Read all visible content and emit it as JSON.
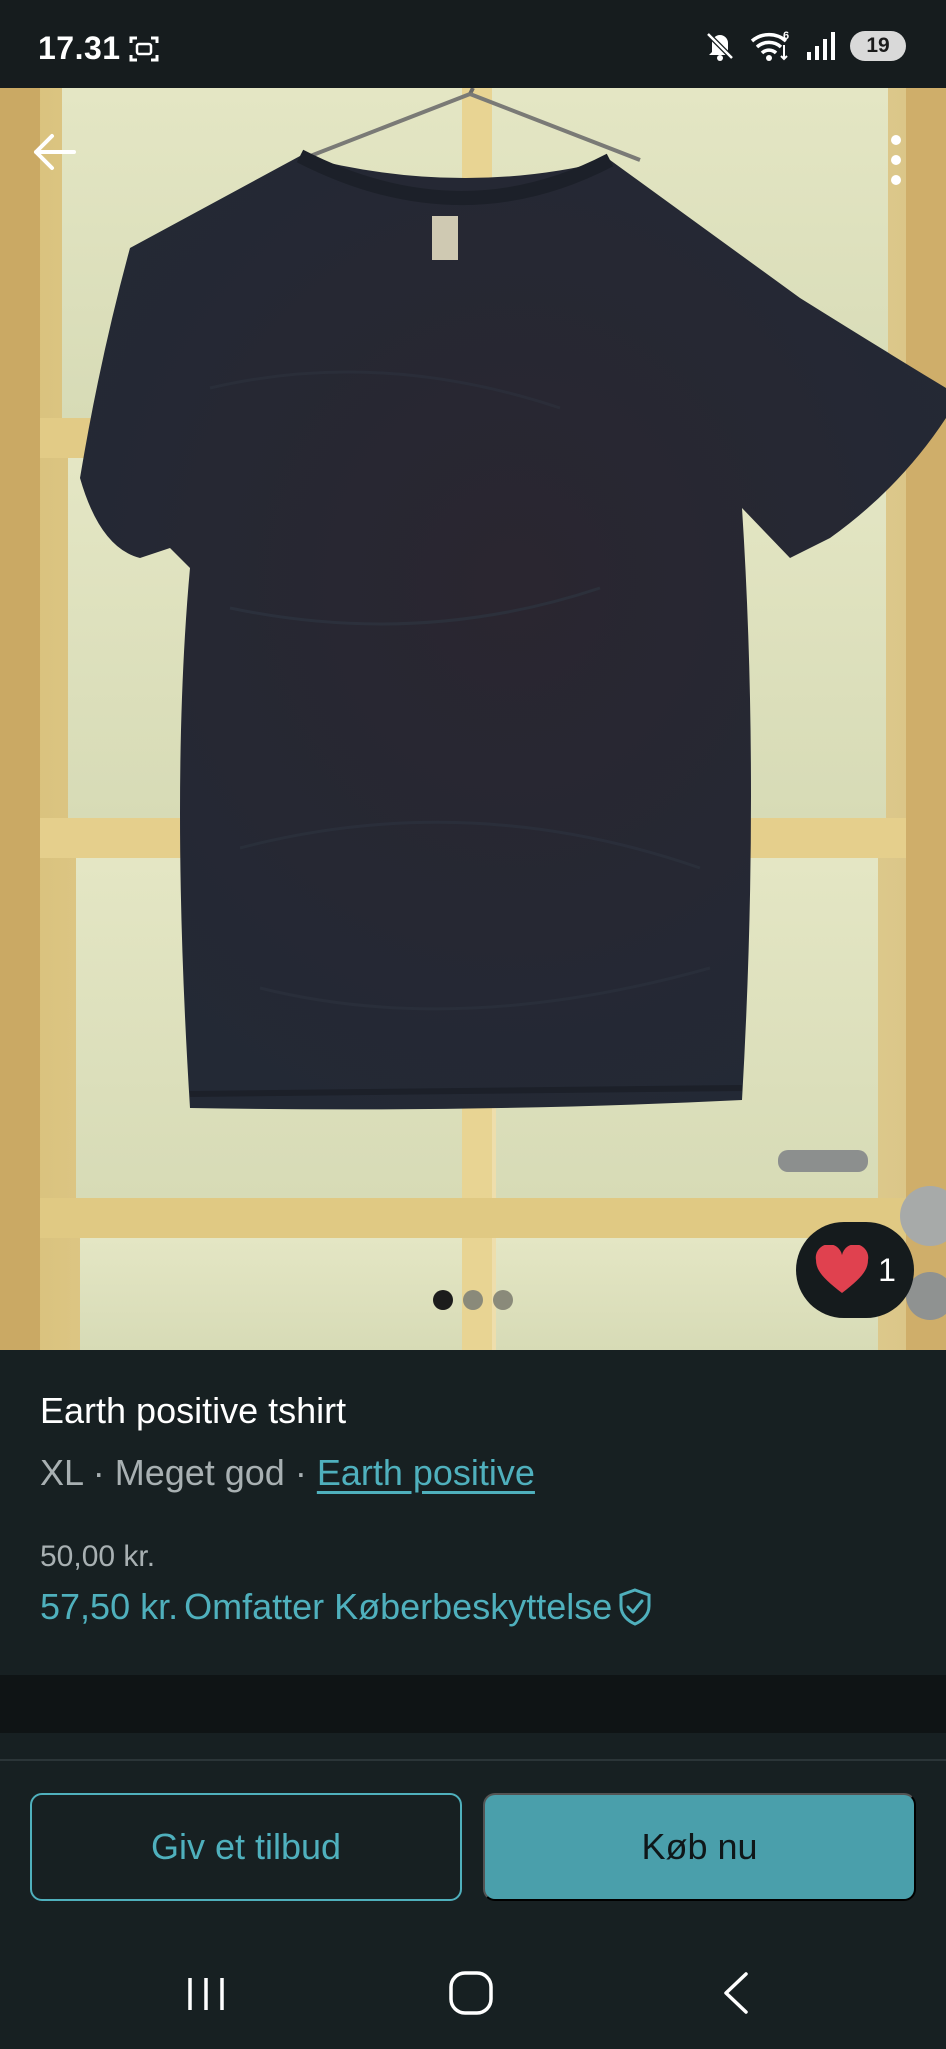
{
  "status_bar": {
    "time": "17.31",
    "battery_level": "19",
    "icons": [
      "screenshot-icon",
      "mute-icon",
      "wifi-icon",
      "signal-icon",
      "battery-icon"
    ]
  },
  "photo": {
    "image_count": 3,
    "active_index": 0,
    "like_count": "1",
    "colors": {
      "shirt": "#262a35",
      "door": "#e6d49a",
      "glass": "#dfe3c2"
    }
  },
  "listing": {
    "title": "Earth positive tshirt",
    "size": "XL",
    "separator": " · ",
    "condition": "Meget god",
    "brand": "Earth positive",
    "price": "50,00 kr.",
    "total_price": "57,50 kr.",
    "protection_note": "Omfatter Køberbeskyttelse"
  },
  "actions": {
    "offer_label": "Giv et tilbud",
    "buy_label": "Køb nu"
  },
  "theme": {
    "accent": "#4fb0bd",
    "buy_bg": "#4a9fab",
    "background": "#172022",
    "like_heart": "#e0414f"
  }
}
